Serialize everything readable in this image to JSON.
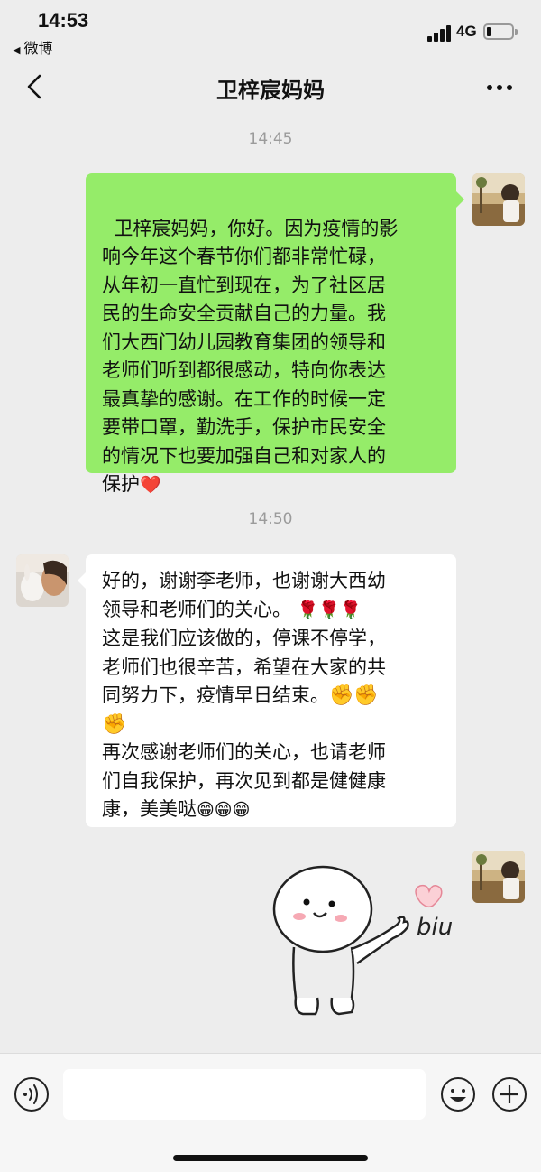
{
  "status_bar": {
    "time": "14:53",
    "back_app": "微博",
    "network": "4G",
    "battery_level": 0.15
  },
  "nav": {
    "title": "卫梓宸妈妈"
  },
  "messages": [
    {
      "timestamp": "14:45",
      "direction": "outgoing",
      "text": "卫梓宸妈妈，你好。因为疫情的影\n响今年这个春节你们都非常忙碌，\n从年初一直忙到现在，为了社区居\n民的生命安全贡献自己的力量。我\n们大西门幼儿园教育集团的领导和\n老师们听到都很感动，特向你表达\n最真挚的感谢。在工作的时候一定\n要带口罩，勤洗手，保护市民安全\n的情况下也要加强自己和对家人的\n保护",
      "emoji": "❤️"
    },
    {
      "timestamp": "14:50",
      "direction": "incoming",
      "line1": "好的，谢谢李老师，也谢谢大西幼",
      "line2": "领导和老师们的关心。",
      "rose_emoji": "🌹🌹🌹",
      "line3": "这是我们应该做的，停课不停学，",
      "line4": "老师们也很辛苦，希望在大家的共",
      "line5": "同努力下，疫情早日结束。",
      "fist_emoji": "✊✊",
      "fist_emoji_2": "✊",
      "line6": "再次感谢老师们的关心，也请老师",
      "line7": "们自我保护，再次见到都是健健康",
      "line8": "康，美美哒",
      "grin_emoji": "😁😁😁"
    },
    {
      "direction": "outgoing",
      "type": "sticker",
      "sticker_text": "biu"
    }
  ],
  "colors": {
    "outgoing_bubble": "#95ec69",
    "incoming_bubble": "#ffffff",
    "background": "#ededed",
    "timestamp": "#9b9b9b"
  },
  "icons": {
    "nav_back": "chevron-left-icon",
    "nav_more": "more-dots-icon",
    "voice": "voice-icon",
    "emoji": "emoji-smile-icon",
    "plus": "plus-icon"
  }
}
